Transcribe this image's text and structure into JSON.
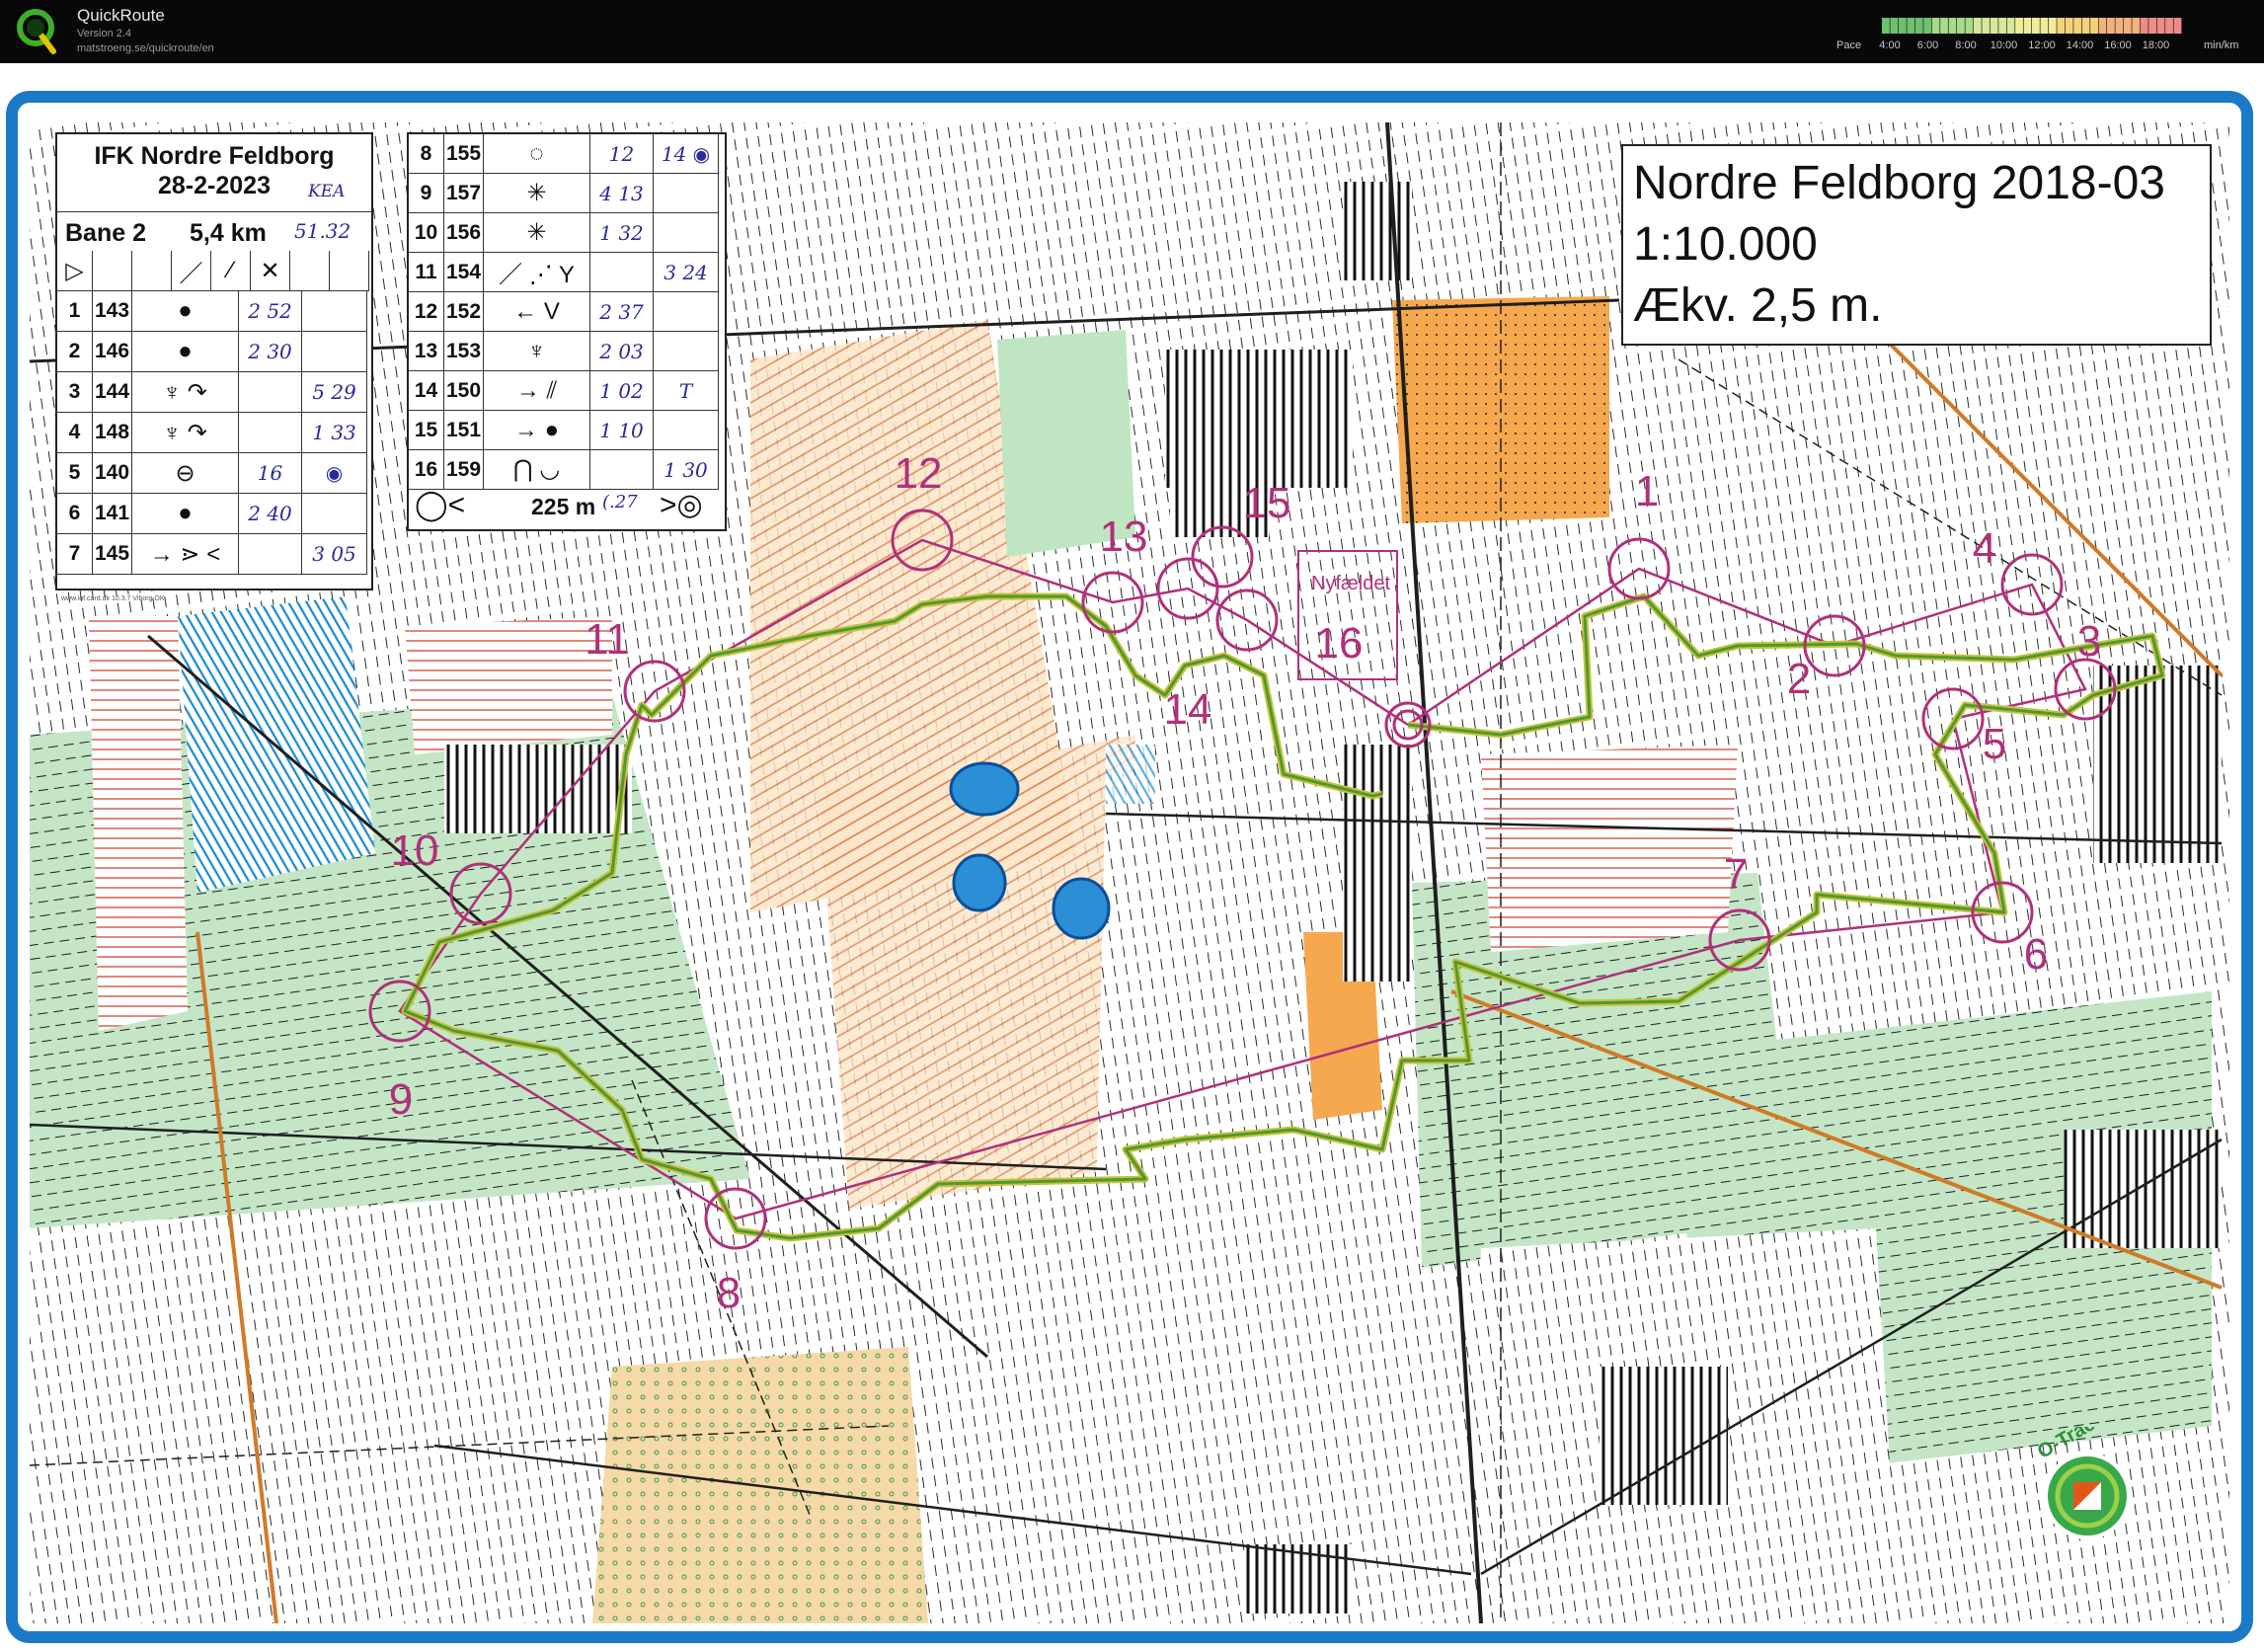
{
  "app": {
    "name": "QuickRoute",
    "version": "Version 2.4",
    "url": "matstroeng.se/quickroute/en",
    "pace_label": "Pace",
    "pace_ticks": [
      "4:00",
      "6:00",
      "8:00",
      "10:00",
      "12:00",
      "14:00",
      "16:00",
      "18:00"
    ],
    "pace_unit": "min/km",
    "pace_colors": [
      "#6fc06f",
      "#a8d88a",
      "#d4e89a",
      "#f0ec9a",
      "#f5d27a",
      "#f2b27e",
      "#ee8a8a"
    ]
  },
  "map": {
    "title": "Nordre Feldborg 2018-03",
    "scale": "1:10.000",
    "contour": "Ækv. 2,5 m.",
    "place_name": "Nyfældet",
    "overprint_color": "#b0307a",
    "route_color": "#5ea23a",
    "controls": [
      {
        "label": "1"
      },
      {
        "label": "2"
      },
      {
        "label": "3"
      },
      {
        "label": "4"
      },
      {
        "label": "5"
      },
      {
        "label": "6"
      },
      {
        "label": "7"
      },
      {
        "label": "8"
      },
      {
        "label": "9"
      },
      {
        "label": "10"
      },
      {
        "label": "11"
      },
      {
        "label": "12"
      },
      {
        "label": "13"
      },
      {
        "label": "14"
      },
      {
        "label": "15"
      },
      {
        "label": "16"
      }
    ],
    "otrack_label": "O-Track"
  },
  "description_left": {
    "club": "IFK Nordre Feldborg",
    "date": "28-2-2023",
    "date_note": "KEA",
    "course": "Bane 2",
    "length": "5,4 km",
    "total_time": "51.32",
    "header_symbols": [
      "▷",
      "",
      "",
      "／",
      "⁄",
      "✕",
      "",
      ""
    ],
    "rows": [
      {
        "n": "1",
        "code": "143",
        "sym": "●",
        "split": "2 52",
        "note": ""
      },
      {
        "n": "2",
        "code": "146",
        "sym": "●",
        "split": "2 30",
        "note": ""
      },
      {
        "n": "3",
        "code": "144",
        "sym": "♆ ↷",
        "split": "",
        "note": "5 29"
      },
      {
        "n": "4",
        "code": "148",
        "sym": "♆ ↷",
        "split": "",
        "note": "1 33"
      },
      {
        "n": "5",
        "code": "140",
        "sym": "⊖",
        "split": "16",
        "note": "◉"
      },
      {
        "n": "6",
        "code": "141",
        "sym": "●",
        "split": "2 40",
        "note": ""
      },
      {
        "n": "7",
        "code": "145",
        "sym": "→ ⋗ <",
        "split": "",
        "note": "3 05"
      }
    ],
    "footer": "www.iof.card.dk 10.3.7 Viborg OK"
  },
  "description_right": {
    "rows": [
      {
        "n": "8",
        "code": "155",
        "sym": "◌",
        "split": "12",
        "note": "14 ◉"
      },
      {
        "n": "9",
        "code": "157",
        "sym": "✳",
        "split": "4 13",
        "note": ""
      },
      {
        "n": "10",
        "code": "156",
        "sym": "✳",
        "split": "1 32",
        "note": ""
      },
      {
        "n": "11",
        "code": "154",
        "sym": "／ ⋰ Y",
        "split": "",
        "note": "3 24"
      },
      {
        "n": "12",
        "code": "152",
        "sym": "← V",
        "split": "2 37",
        "note": ""
      },
      {
        "n": "13",
        "code": "153",
        "sym": "♆",
        "split": "2 03",
        "note": ""
      },
      {
        "n": "14",
        "code": "150",
        "sym": "→ ⫽",
        "split": "1 02",
        "note": "T"
      },
      {
        "n": "15",
        "code": "151",
        "sym": "→ ●",
        "split": "1 10",
        "note": ""
      },
      {
        "n": "16",
        "code": "159",
        "sym": "⋂ ◡",
        "split": "",
        "note": "1 30"
      }
    ],
    "finish_text": "225 m",
    "finish_note": "(.27",
    "finish_symbols_left": "◯<",
    "finish_symbols_right": ">◎"
  }
}
